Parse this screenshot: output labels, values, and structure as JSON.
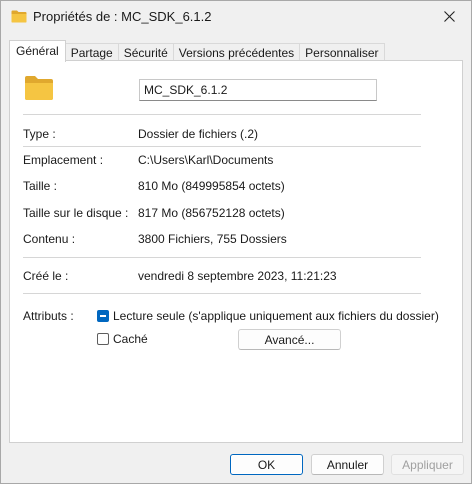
{
  "window": {
    "title": "Propriétés de : MC_SDK_6.1.2"
  },
  "tabs": [
    {
      "label": "Général"
    },
    {
      "label": "Partage"
    },
    {
      "label": "Sécurité"
    },
    {
      "label": "Versions précédentes"
    },
    {
      "label": "Personnaliser"
    }
  ],
  "general": {
    "name_value": "MC_SDK_6.1.2",
    "type_label": "Type :",
    "type_value": "Dossier de fichiers (.2)",
    "location_label": "Emplacement :",
    "location_value": "C:\\Users\\Karl\\Documents",
    "size_label": "Taille :",
    "size_value": "810 Mo (849995854 octets)",
    "disk_size_label": "Taille sur le disque :",
    "disk_size_value": "817 Mo (856752128 octets)",
    "contents_label": "Contenu :",
    "contents_value": "3800 Fichiers, 755 Dossiers",
    "created_label": "Créé le :",
    "created_value": "vendredi 8 septembre 2023, 11:21:23",
    "attributes_label": "Attributs :",
    "readonly_label": "Lecture seule (s'applique uniquement aux fichiers du dossier)",
    "readonly_state": "indeterminate",
    "hidden_label": "Caché",
    "hidden_state": "unchecked",
    "advanced_button": "Avancé..."
  },
  "footer": {
    "ok_label": "OK",
    "cancel_label": "Annuler",
    "apply_label": "Appliquer"
  },
  "colors": {
    "accent": "#0067c0",
    "folder": "#f5c542",
    "folder_dark": "#e0a82e"
  },
  "icons": {
    "title_icon": "folder-icon",
    "close_icon": "close-icon",
    "big_icon": "folder-icon"
  }
}
